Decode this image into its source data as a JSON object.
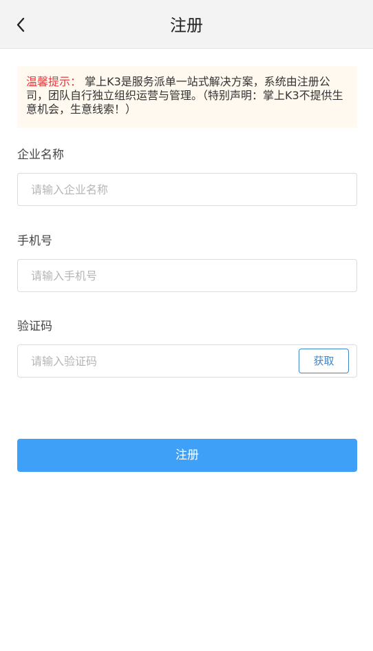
{
  "header": {
    "title": "注册",
    "back_icon": "chevron-left-icon"
  },
  "notice": {
    "label": "温馨提示：",
    "text": " 掌上K3是服务派单一站式解决方案，系统由注册公司，团队自行独立组织运营与管理。（特别声明：掌上K3不提供生意机会，生意线索！）"
  },
  "form": {
    "company": {
      "label": "企业名称",
      "placeholder": "请输入企业名称",
      "value": ""
    },
    "phone": {
      "label": "手机号",
      "placeholder": "请输入手机号",
      "value": ""
    },
    "code": {
      "label": "验证码",
      "placeholder": "请输入验证码",
      "value": "",
      "get_code_label": "获取"
    },
    "submit_label": "注册"
  },
  "colors": {
    "primary": "#3fa0f7",
    "link_blue": "#3a86c8",
    "notice_label": "#e8383d",
    "notice_bg": "#fff9ef",
    "nav_bg": "#f3f3f3"
  }
}
